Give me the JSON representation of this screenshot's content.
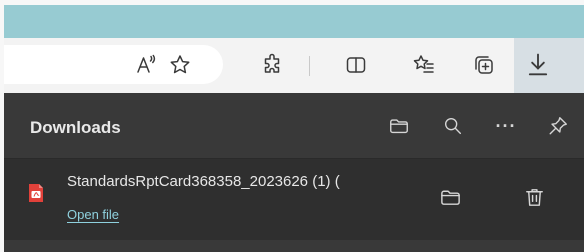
{
  "toolbar": {
    "icons": [
      "read-aloud-icon",
      "favorite-star-icon",
      "extensions-puzzle-icon",
      "split-screen-icon",
      "favorites-list-icon",
      "collections-icon",
      "downloads-icon"
    ]
  },
  "downloads_panel": {
    "title": "Downloads",
    "header_icons": [
      "open-folder-icon",
      "search-icon",
      "more-options-icon",
      "pin-icon"
    ],
    "more_label": "···",
    "items": [
      {
        "file_name": "StandardsRptCard368358_2023626 (1) (",
        "file_type_icon": "pdf-icon",
        "action_label": "Open file",
        "buttons": [
          "show-in-folder-icon",
          "delete-icon"
        ]
      }
    ]
  },
  "colors": {
    "title_bar": "#97cbd2",
    "toolbar": "#f3f3f3",
    "panel": "#393939",
    "item": "#2f2f2f",
    "link": "#8fd1de",
    "pdf_red": "#e1413a"
  }
}
